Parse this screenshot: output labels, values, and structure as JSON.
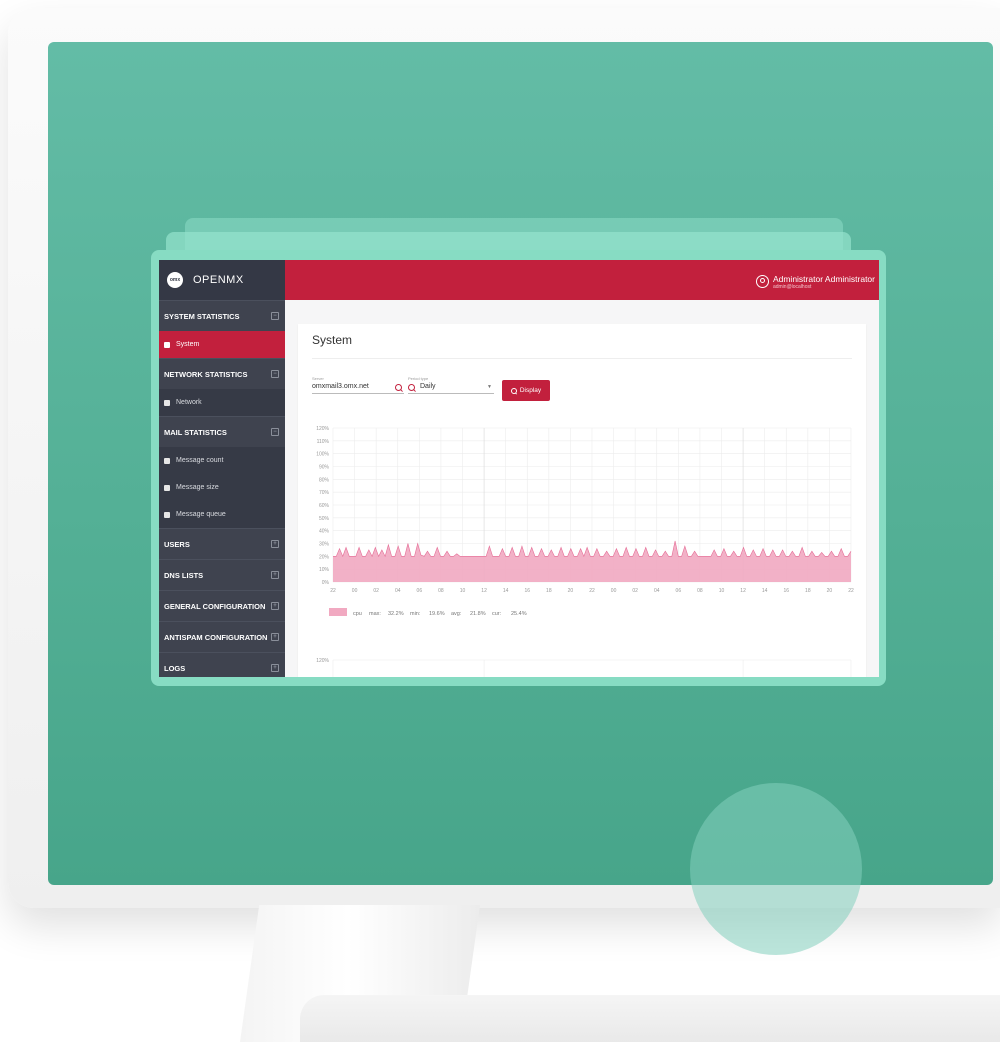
{
  "app": {
    "brand": "OPENMX",
    "logo_text": "omx"
  },
  "user": {
    "name": "Administrator Administrator",
    "email": "admin@localhost"
  },
  "sidebar": {
    "sections": [
      {
        "label": "SYSTEM STATISTICS",
        "items": [
          {
            "label": "System",
            "active": true
          }
        ]
      },
      {
        "label": "NETWORK STATISTICS",
        "items": [
          {
            "label": "Network",
            "active": false
          }
        ]
      },
      {
        "label": "MAIL STATISTICS",
        "items": [
          {
            "label": "Message count",
            "active": false
          },
          {
            "label": "Message size",
            "active": false
          },
          {
            "label": "Message queue",
            "active": false
          }
        ]
      },
      {
        "label": "USERS",
        "items": []
      },
      {
        "label": "DNS LISTS",
        "items": []
      },
      {
        "label": "GENERAL CONFIGURATION",
        "items": []
      },
      {
        "label": "ANTISPAM CONFIGURATION",
        "items": []
      },
      {
        "label": "LOGS",
        "items": []
      }
    ]
  },
  "page": {
    "title": "System",
    "server_label": "Server",
    "server_value": "omxmail3.omx.net",
    "period_label": "Period type",
    "period_value": "Daily",
    "display_button": "Display"
  },
  "colors": {
    "accent": "#c2203d",
    "series": "#f1a9c1",
    "series_line": "#e56d96"
  },
  "chart_data": {
    "type": "area",
    "y_ticks": [
      "120%",
      "110%",
      "100%",
      "90%",
      "80%",
      "70%",
      "60%",
      "50%",
      "40%",
      "30%",
      "20%",
      "10%",
      "0%"
    ],
    "ylim": [
      0,
      120
    ],
    "x_ticks": [
      "22",
      "00",
      "02",
      "04",
      "06",
      "08",
      "10",
      "12",
      "14",
      "16",
      "18",
      "20",
      "22",
      "00",
      "02",
      "04",
      "06",
      "08",
      "10",
      "12",
      "14",
      "16",
      "18",
      "20",
      "22"
    ],
    "series": [
      {
        "name": "cpu",
        "baseline": 20,
        "values": [
          20,
          20,
          26,
          20,
          27,
          20,
          20,
          20,
          27,
          20,
          20,
          25,
          20,
          27,
          20,
          25,
          20,
          29,
          20,
          20,
          28,
          20,
          20,
          30,
          20,
          20,
          30,
          21,
          20,
          24,
          20,
          20,
          27,
          20,
          20,
          24,
          20,
          20,
          22,
          20,
          20,
          20,
          20,
          20,
          20,
          20,
          20,
          20,
          28,
          20,
          20,
          20,
          26,
          20,
          20,
          27,
          20,
          20,
          28,
          20,
          20,
          27,
          20,
          20,
          26,
          20,
          20,
          25,
          20,
          20,
          27,
          20,
          20,
          26,
          20,
          20,
          26,
          20,
          27,
          20,
          20,
          26,
          20,
          20,
          24,
          20,
          20,
          26,
          20,
          20,
          27,
          20,
          20,
          26,
          20,
          20,
          27,
          20,
          20,
          25,
          20,
          20,
          24,
          20,
          20,
          32,
          20,
          20,
          28,
          20,
          20,
          24,
          20,
          20,
          20,
          20,
          20,
          25,
          20,
          20,
          26,
          20,
          20,
          24,
          20,
          20,
          27,
          20,
          20,
          25,
          20,
          20,
          26,
          20,
          20,
          25,
          20,
          20,
          25,
          20,
          20,
          24,
          20,
          20,
          27,
          20,
          20,
          24,
          20,
          20,
          23,
          20,
          20,
          24,
          20,
          20,
          26,
          20,
          20,
          24
        ]
      }
    ],
    "legend": {
      "name": "cpu",
      "max_label": "max:",
      "max": "32.2%",
      "min_label": "min:",
      "min": "19.6%",
      "avg_label": "avg:",
      "avg": "21.8%",
      "current_label": "cur:",
      "current": "25.4%"
    },
    "second_chart_top_label": "120%"
  }
}
